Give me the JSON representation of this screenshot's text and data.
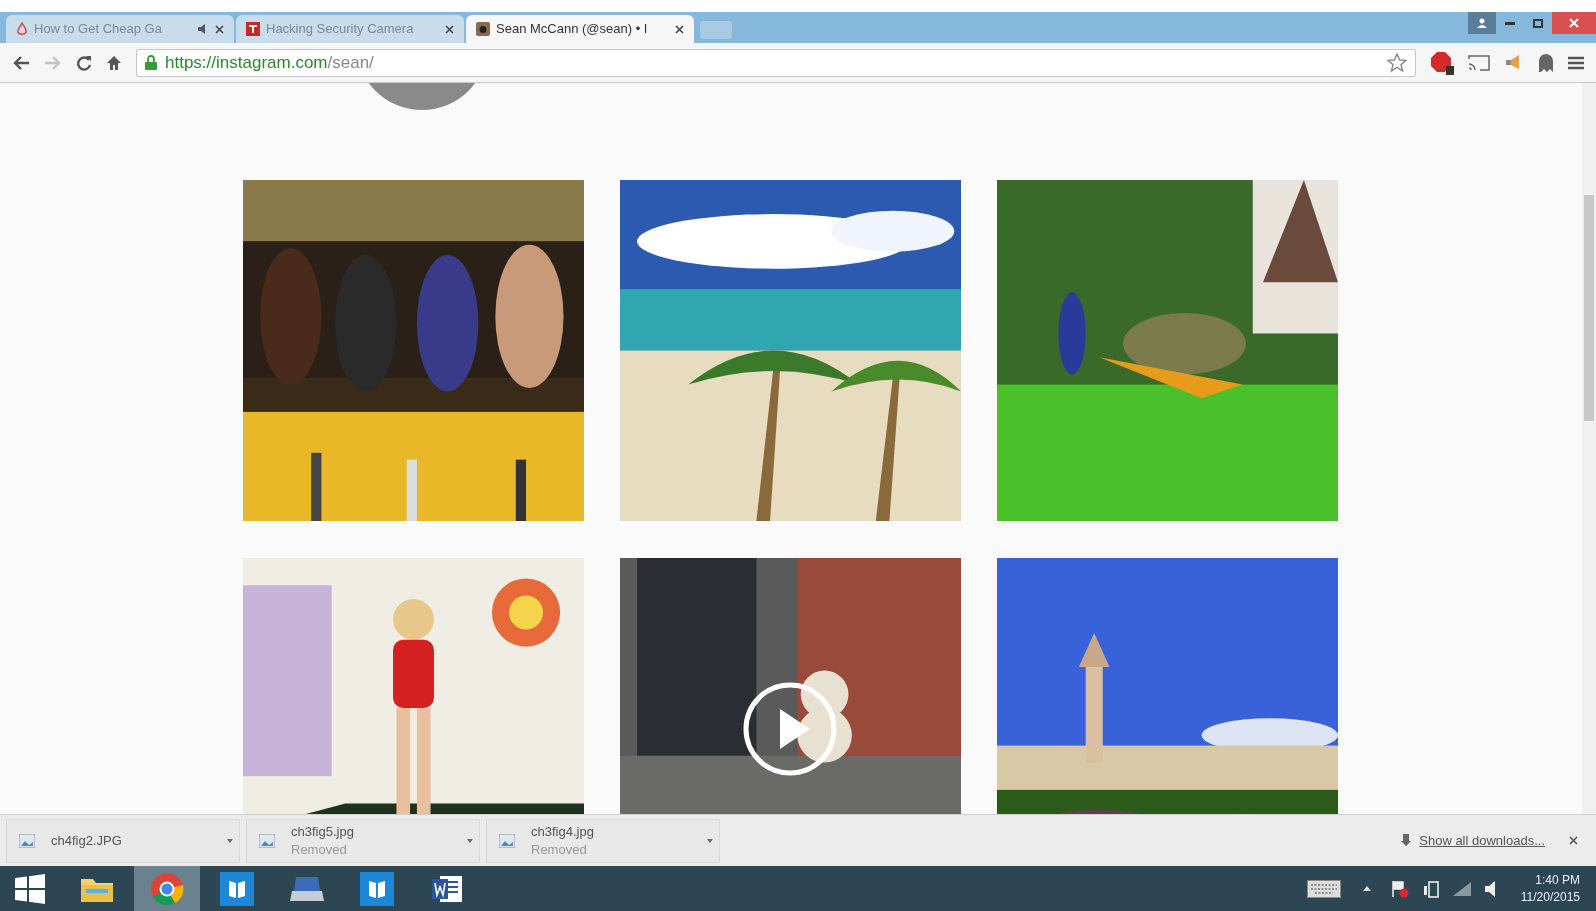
{
  "tabs": [
    {
      "title": "How to Get Cheap Ga",
      "audio": true,
      "selected": false
    },
    {
      "title": "Hacking Security Camera",
      "audio": false,
      "selected": false
    },
    {
      "title": "Sean McCann (@sean) • I",
      "audio": false,
      "selected": true
    }
  ],
  "address_bar": {
    "host": "https://instagram.com",
    "path": "/sean/"
  },
  "photos": [
    {
      "kind": "picture",
      "video": false
    },
    {
      "kind": "picture",
      "video": false
    },
    {
      "kind": "picture",
      "video": false
    },
    {
      "kind": "picture",
      "video": false
    },
    {
      "kind": "picture",
      "video": true
    },
    {
      "kind": "picture",
      "video": false
    }
  ],
  "downloads": [
    {
      "name": "ch4fig2.JPG"
    },
    {
      "name": "ch3fig5.jpg",
      "status": "Removed"
    },
    {
      "name": "ch3fig4.jpg",
      "status": "Removed"
    }
  ],
  "show_all_downloads": "Show all downloads...",
  "taskbar": {
    "apps": [
      {
        "selected": false
      },
      {
        "selected": true
      },
      {
        "selected": false
      },
      {
        "selected": false
      },
      {
        "selected": false
      },
      {
        "selected": false
      }
    ],
    "time": "1:40 PM",
    "date": "11/20/2015"
  }
}
